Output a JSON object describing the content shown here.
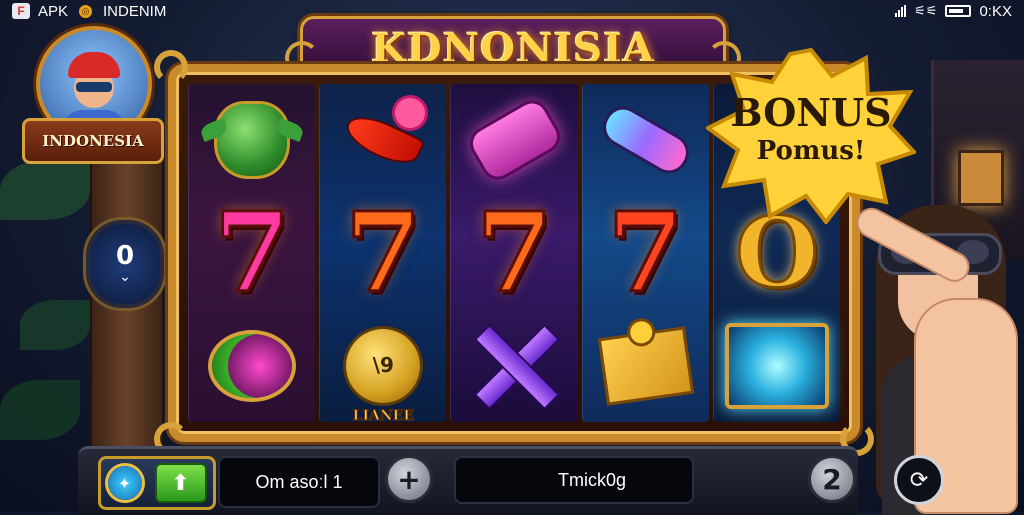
{
  "status_bar": {
    "app_label_prefix": "APK",
    "app_label_suffix": "INDENIM",
    "time_text": "0:KX"
  },
  "header": {
    "title": "KDNONISIA"
  },
  "profile": {
    "country_label": "INDONESIA"
  },
  "side_counter": {
    "value": "0"
  },
  "bonus": {
    "title": "BONUS",
    "subtitle": "Pomus!"
  },
  "reels": [
    {
      "symbols": [
        "green-pot",
        "seven-pink",
        "drum"
      ]
    },
    {
      "symbols": [
        "chili-rose",
        "seven-orange",
        "coin-bag"
      ]
    },
    {
      "symbols": [
        "pink-scroll",
        "seven-orange",
        "purple-x"
      ]
    },
    {
      "symbols": [
        "blue-tube",
        "seven-red",
        "gold-chest"
      ]
    },
    {
      "symbols": [
        "bonus-burst",
        "gold-o",
        "crystal"
      ]
    }
  ],
  "symbol_labels": {
    "seven": "7",
    "gold_o": "O",
    "coin_bag_text": "LIANEE",
    "coin_face": "\\9"
  },
  "controls": {
    "bet_field": "Om asoːl 1",
    "plus_label": "+",
    "info_field": "Tmick0g",
    "autoplay_label": "2"
  },
  "colors": {
    "frame_gold": "#c88a2a",
    "title_gold": "#ffd24a",
    "bonus_yellow": "#ffd23a"
  }
}
